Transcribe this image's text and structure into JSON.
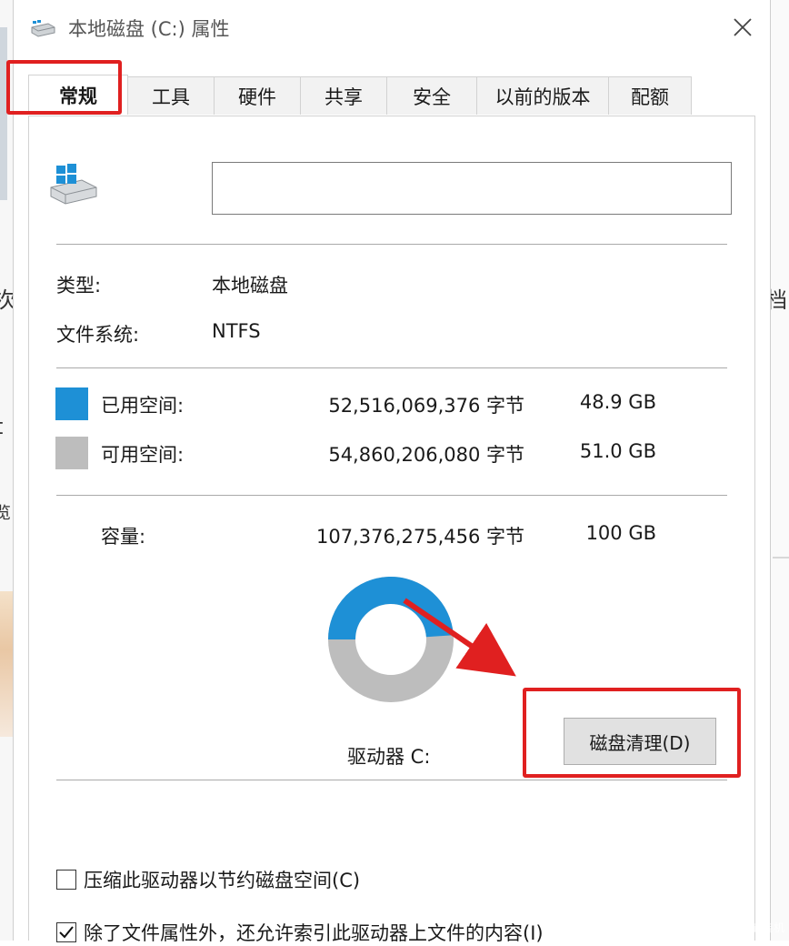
{
  "colors": {
    "used": "#1e90d6",
    "free": "#bdbdbd",
    "annotation": "#e02020"
  },
  "window": {
    "title": "本地磁盘 (C:) 属性",
    "icon": "drive-icon",
    "close_icon": "close-icon"
  },
  "tabs": [
    {
      "label": "常规",
      "active": true
    },
    {
      "label": "工具"
    },
    {
      "label": "硬件"
    },
    {
      "label": "共享"
    },
    {
      "label": "安全"
    },
    {
      "label": "以前的版本"
    },
    {
      "label": "配额"
    }
  ],
  "general": {
    "name_value": "",
    "type_label": "类型:",
    "type_value": "本地磁盘",
    "fs_label": "文件系统:",
    "fs_value": "NTFS",
    "used": {
      "label": "已用空间:",
      "bytes": "52,516,069,376 字节",
      "size": "48.9 GB"
    },
    "free": {
      "label": "可用空间:",
      "bytes": "54,860,206,080 字节",
      "size": "51.0 GB"
    },
    "capacity": {
      "label": "容量:",
      "bytes": "107,376,275,456 字节",
      "size": "100 GB"
    },
    "used_fraction": 0.489,
    "drive_label": "驱动器 C:",
    "cleanup_button": "磁盘清理(D)",
    "compress_label": "压缩此驱动器以节约磁盘空间(C)",
    "compress_checked": false,
    "index_label": "除了文件属性外，还允许索引此驱动器上文件的内容(I)",
    "index_checked": true
  }
}
